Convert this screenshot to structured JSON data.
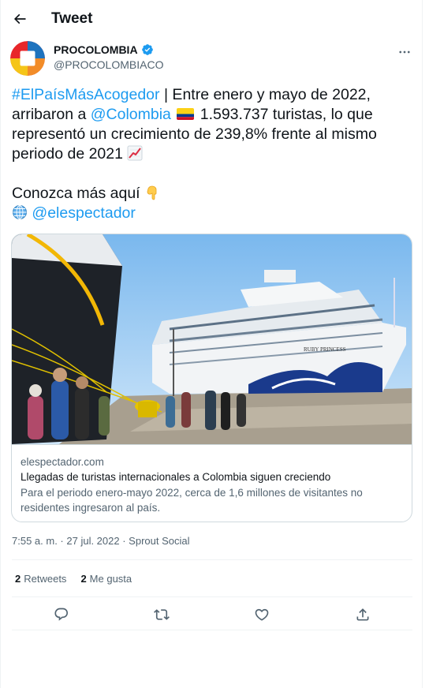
{
  "header": {
    "title": "Tweet"
  },
  "author": {
    "name": "PROCOLOMBIA",
    "handle": "@PROCOLOMBIACO"
  },
  "tweet": {
    "hashtag": "#ElPaísMásAcogedor",
    "text_1": " | Entre enero y mayo de 2022, arribaron a ",
    "mention": "@Colombia",
    "text_2": " 1.593.737 turistas, lo que representó un crecimiento de 239,8% frente al mismo periodo de 2021 ",
    "text_3": "Conozca más aquí ",
    "link_mention": "@elespectador"
  },
  "card": {
    "domain": "elespectador.com",
    "title": "Llegadas de turistas internacionales a Colombia siguen creciendo",
    "description": "Para el periodo enero-mayo 2022, cerca de 1,6 millones de visitantes no residentes ingresaron al país.",
    "ship_name": "RUBY PRINCESS"
  },
  "meta": {
    "time": "7:55 a. m.",
    "sep1": " · ",
    "date": "27 jul. 2022",
    "sep2": " · ",
    "source": "Sprout Social"
  },
  "stats": {
    "retweets_count": "2",
    "retweets_label": "Retweets",
    "likes_count": "2",
    "likes_label": "Me gusta"
  },
  "icons": {
    "back": "arrow-left-icon",
    "more": "more-icon",
    "verified": "verified-badge-icon",
    "flag": "colombia-flag-icon",
    "chart": "chart-increasing-icon",
    "point": "pointing-down-icon",
    "globe": "globe-icon",
    "reply": "reply-icon",
    "retweet": "retweet-icon",
    "like": "heart-icon",
    "share": "share-icon"
  },
  "colors": {
    "accent": "#1d9bf0",
    "text": "#0f1419",
    "muted": "#536471",
    "border": "#cfd9de"
  }
}
